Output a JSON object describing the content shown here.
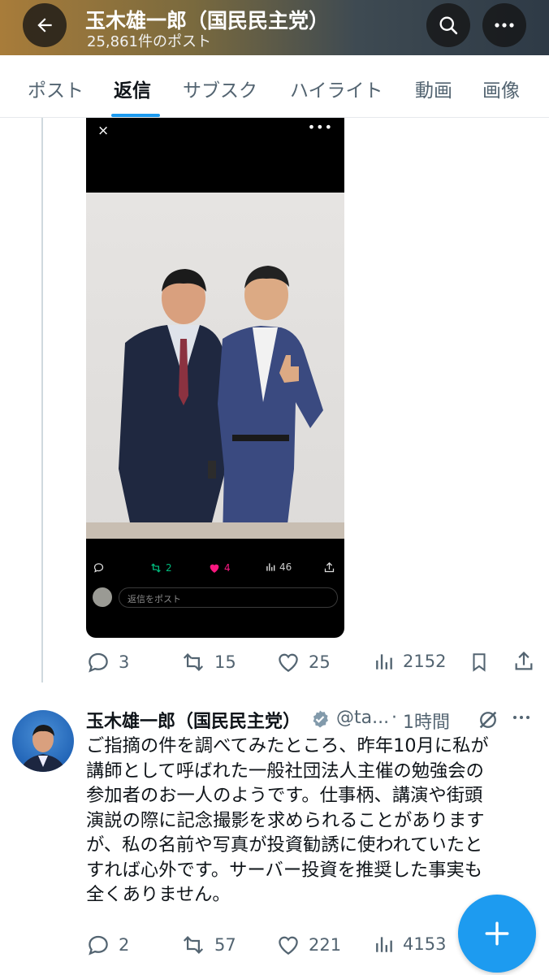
{
  "header": {
    "title": "玉木雄一郎（国民民主党）",
    "post_count": "25,861件のポスト"
  },
  "tabs": [
    {
      "label": "ポスト"
    },
    {
      "label": "返信"
    },
    {
      "label": "サブスク"
    },
    {
      "label": "ハイライト"
    },
    {
      "label": "動画"
    },
    {
      "label": "画像"
    }
  ],
  "embed": {
    "close": "×",
    "more": "•••",
    "retweets": "2",
    "likes": "4",
    "views": "46",
    "reply_placeholder": "返信をポスト"
  },
  "post1": {
    "replies": "3",
    "reposts": "15",
    "likes": "25",
    "views": "2152"
  },
  "post2": {
    "author": "玉木雄一郎（国民民主党）",
    "handle": "@ta...",
    "separator": "·",
    "time": "1時間",
    "text_lines": [
      "ご指摘の件を調べてみたところ、昨年10月に私が",
      "講師として呼ばれた一般社団法人主催の勉強会の",
      "参加者のお一人のようです。仕事柄、講演や街頭",
      "演説の際に記念撮影を求められることがあります",
      "が、私の名前や写真が投資勧誘に使われていたと",
      "すれば心外です。サーバー投資を推奨した事実も",
      "全くありません。"
    ],
    "replies": "2",
    "reposts": "57",
    "likes": "221",
    "views": "4153"
  },
  "colors": {
    "accent": "#1d9bf0",
    "like_pink": "#f91880",
    "retweet_green": "#00ba7c",
    "muted": "#536471"
  }
}
